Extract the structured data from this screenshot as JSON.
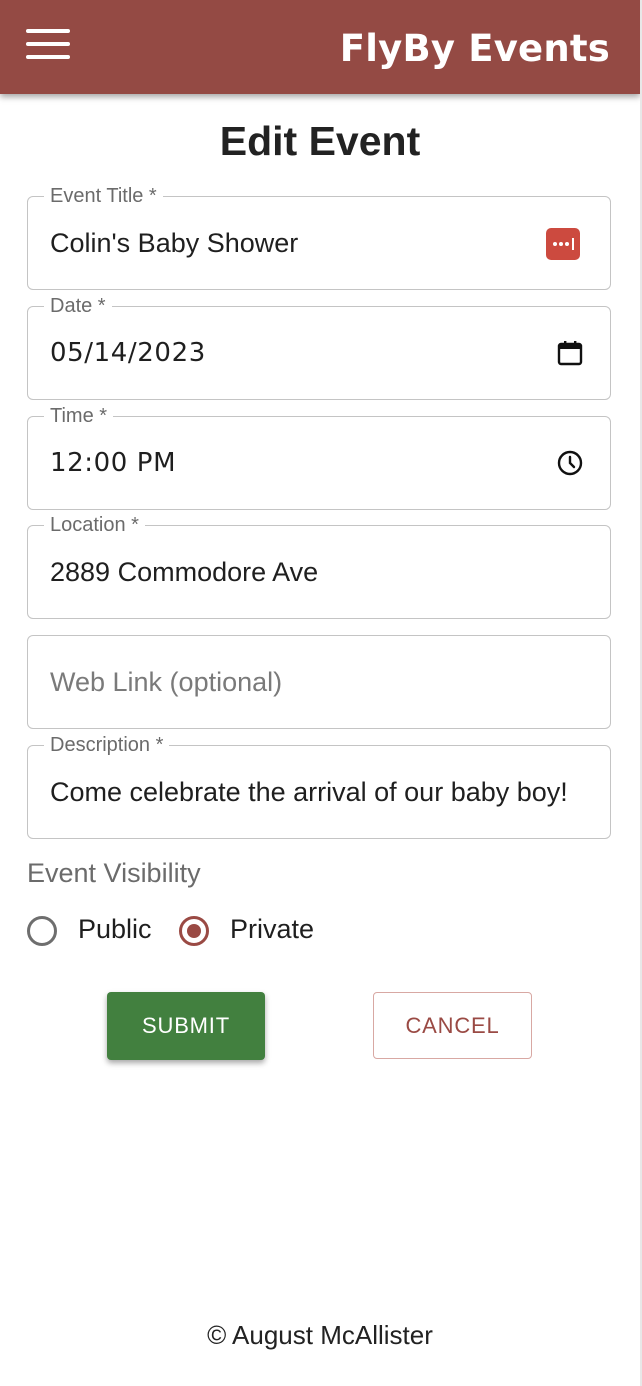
{
  "header": {
    "brand": "FlyBy Events",
    "menu_icon": "hamburger-menu-icon",
    "background_color": "#944a44"
  },
  "page": {
    "title": "Edit Event"
  },
  "form": {
    "event_title": {
      "label": "Event Title *",
      "value": "Colin's Baby Shower",
      "icon": "password-manager-icon"
    },
    "date": {
      "label": "Date *",
      "value": "05/14/2023",
      "icon": "calendar-icon"
    },
    "time": {
      "label": "Time *",
      "value": "12:00 PM",
      "icon": "clock-icon"
    },
    "location": {
      "label": "Location *",
      "value": "2889 Commodore Ave"
    },
    "web_link": {
      "placeholder": "Web Link (optional)",
      "value": ""
    },
    "description": {
      "label": "Description *",
      "value": "Come celebrate the arrival of our baby boy!"
    },
    "visibility": {
      "label": "Event Visibility",
      "options": [
        {
          "label": "Public",
          "checked": false
        },
        {
          "label": "Private",
          "checked": true
        }
      ]
    }
  },
  "actions": {
    "submit_label": "SUBMIT",
    "cancel_label": "CANCEL",
    "submit_color": "#42803f",
    "cancel_color": "#9a4a44"
  },
  "footer": {
    "text": "© August McAllister"
  }
}
